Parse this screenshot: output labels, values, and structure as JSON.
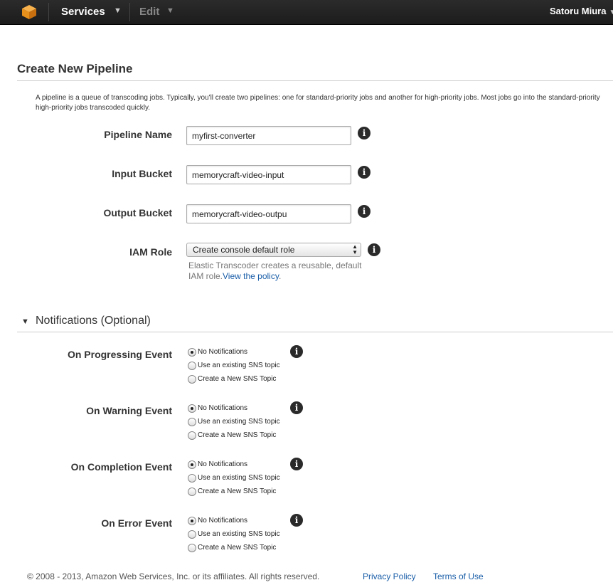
{
  "topbar": {
    "logo_icon": "aws-cube-icon",
    "services_label": "Services",
    "edit_label": "Edit",
    "user_name": "Satoru Miura"
  },
  "page": {
    "title": "Create New Pipeline",
    "intro_line1": "A pipeline is a queue of transcoding jobs. Typically, you'll create two pipelines: one for standard-priority jobs and another for high-priority jobs. Most jobs go into the standard-priority",
    "intro_line2": "high-priority jobs transcoded quickly."
  },
  "form": {
    "pipeline_name": {
      "label": "Pipeline Name",
      "value": "myfirst-converter"
    },
    "input_bucket": {
      "label": "Input Bucket",
      "value": "memorycraft-video-input"
    },
    "output_bucket": {
      "label": "Output Bucket",
      "value": "memorycraft-video-outpu"
    },
    "iam_role": {
      "label": "IAM Role",
      "selected": "Create console default role",
      "help_text": "Elastic Transcoder creates a reusable, default IAM role.",
      "help_link": "View the policy"
    }
  },
  "notifications": {
    "section_title": "Notifications (Optional)",
    "option_labels": [
      "No Notifications",
      "Use an existing SNS topic",
      "Create a New SNS Topic"
    ],
    "events": [
      {
        "label": "On Progressing Event",
        "selected": 0
      },
      {
        "label": "On Warning Event",
        "selected": 0
      },
      {
        "label": "On Completion Event",
        "selected": 0
      },
      {
        "label": "On Error Event",
        "selected": 0
      }
    ]
  },
  "footer": {
    "copyright": "© 2008 - 2013, Amazon Web Services, Inc. or its affiliates. All rights reserved.",
    "privacy_link": "Privacy Policy",
    "terms_link": "Terms of Use"
  },
  "icons": {
    "info": "info-icon",
    "dropdown": "select-arrows-icon",
    "collapse": "triangle-down-icon"
  }
}
